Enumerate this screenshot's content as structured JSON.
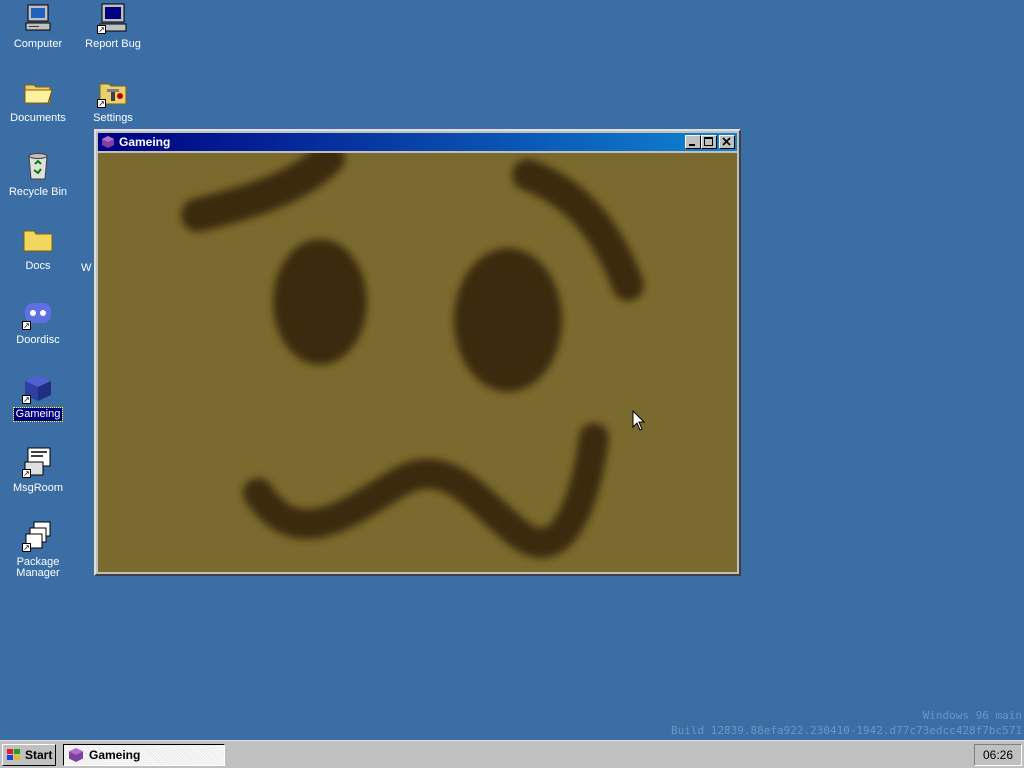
{
  "desktop": {
    "icons": [
      {
        "label": "Computer",
        "icon": "computer-icon"
      },
      {
        "label": "Report Bug",
        "icon": "report-bug-icon"
      },
      {
        "label": "Documents",
        "icon": "folder-open-icon"
      },
      {
        "label": "Settings",
        "icon": "settings-icon"
      },
      {
        "label": "Recycle Bin",
        "icon": "recycle-bin-icon"
      },
      {
        "label": "Docs",
        "icon": "folder-icon"
      },
      {
        "label": "Doordisc",
        "icon": "doordisc-icon"
      },
      {
        "label": "Gameing",
        "icon": "gameing-cube-icon",
        "selected": true
      },
      {
        "label": "MsgRoom",
        "icon": "msgroom-icon"
      },
      {
        "label": "Package Manager",
        "icon": "package-manager-icon"
      }
    ],
    "partial_label": "W"
  },
  "window": {
    "title": "Gameing",
    "canvas_bg": "#7b6a2e",
    "face_color": "#3b2a0e"
  },
  "taskbar": {
    "start_label": "Start",
    "task_label": "Gameing",
    "clock": "06:26"
  },
  "watermark": {
    "line1": "Windows 96 main",
    "line2": "Build 12839.88efa922.230410-1942.d77c73edcc428f7bc571"
  },
  "colors": {
    "desktop_bg": "#3a6ea5",
    "title_gradient_start": "#000080",
    "title_gradient_end": "#1084d0",
    "face_bg": "#7b6a2e"
  }
}
